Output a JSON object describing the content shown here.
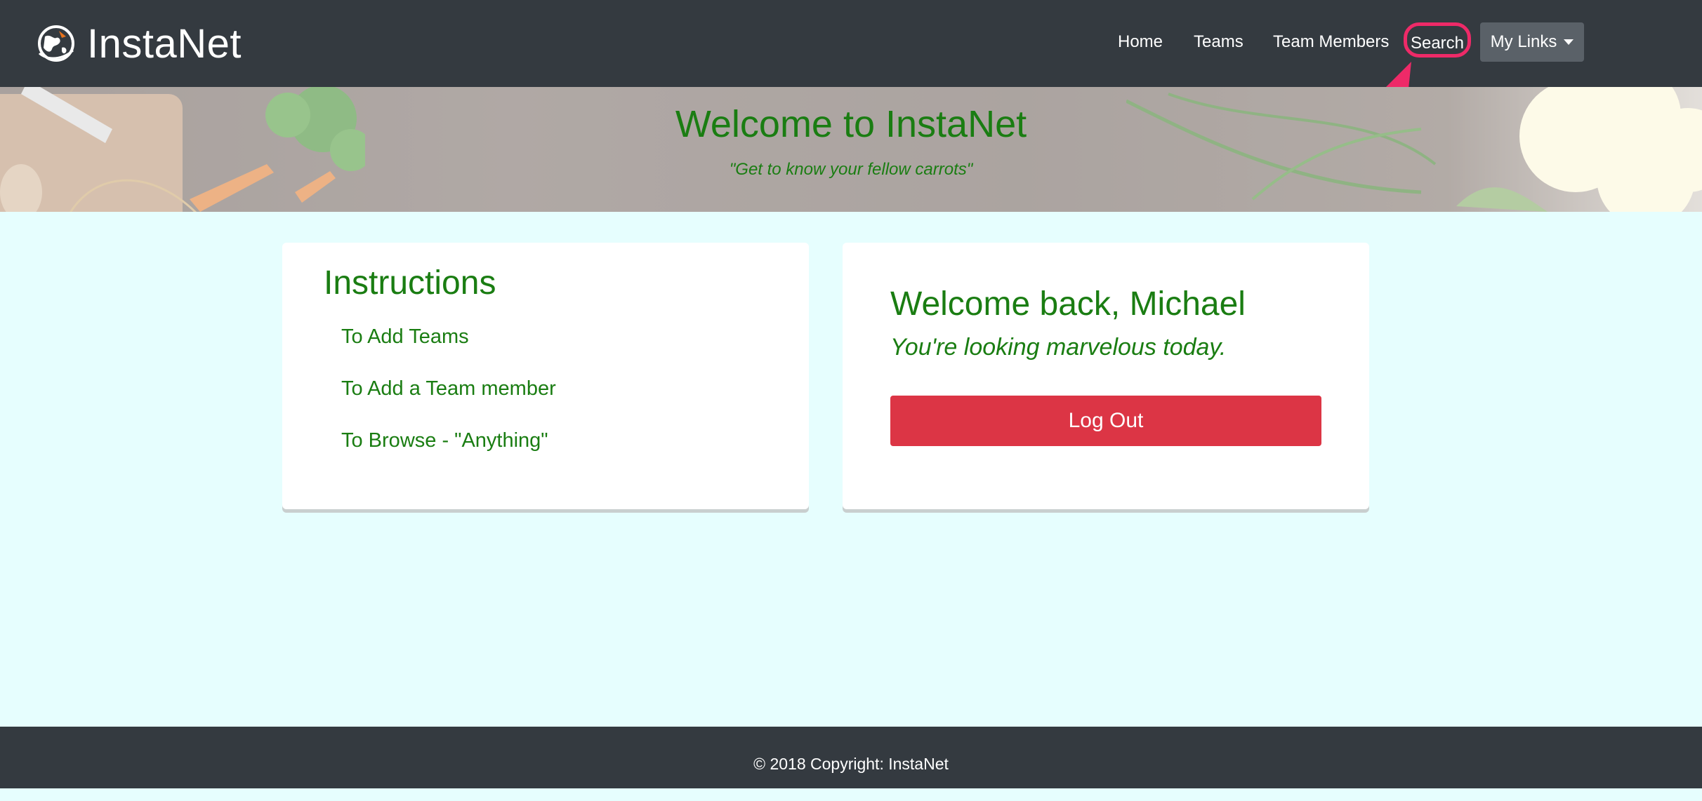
{
  "navbar": {
    "brand": "InstaNet",
    "links": {
      "home": "Home",
      "teams": "Teams",
      "team_members": "Team Members",
      "search": "Search"
    },
    "dropdown_label": "My Links"
  },
  "hero": {
    "title": "Welcome to InstaNet",
    "subtitle": "\"Get to know your fellow carrots\""
  },
  "instructions": {
    "title": "Instructions",
    "links": [
      "To Add Teams",
      "To Add a Team member",
      "To Browse - \"Anything\""
    ]
  },
  "welcome": {
    "title": "Welcome back, Michael",
    "subtitle": "You're looking marvelous today.",
    "logout_label": "Log Out"
  },
  "footer": {
    "text": "© 2018 Copyright: InstaNet"
  },
  "colors": {
    "nav_bg": "#343a40",
    "page_bg": "#e6fefe",
    "accent_green": "#1a7d12",
    "danger": "#dc3545",
    "highlight": "#ee2a68"
  },
  "icons": {
    "brand": "globe-icon",
    "dropdown": "caret-down-icon",
    "annotation": "arrow-icon"
  }
}
